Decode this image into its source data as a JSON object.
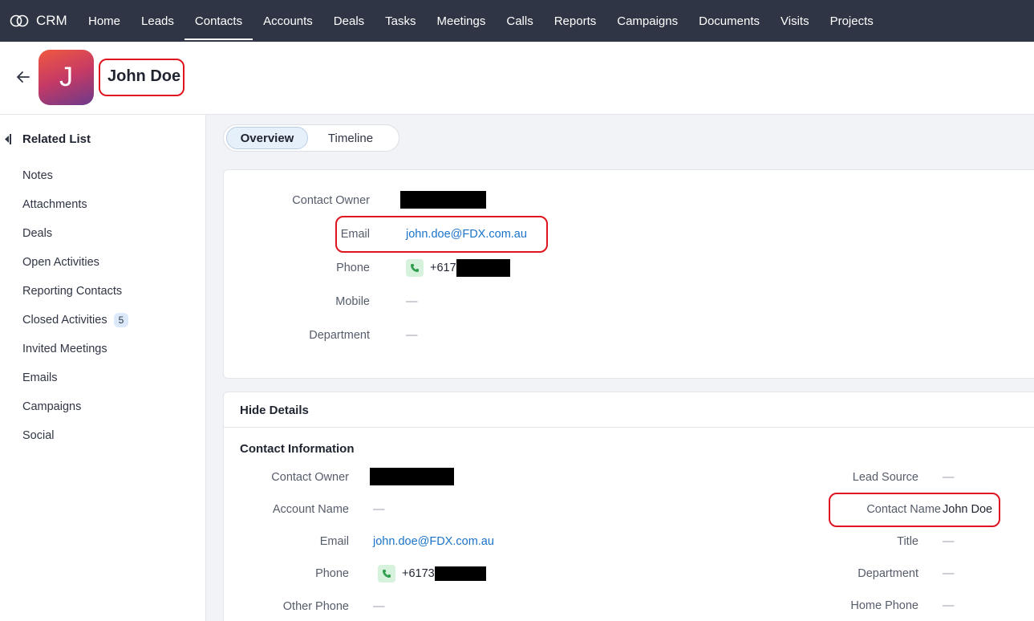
{
  "nav": {
    "brand": "CRM",
    "items": [
      "Home",
      "Leads",
      "Contacts",
      "Accounts",
      "Deals",
      "Tasks",
      "Meetings",
      "Calls",
      "Reports",
      "Campaigns",
      "Documents",
      "Visits",
      "Projects"
    ],
    "active": "Contacts"
  },
  "record": {
    "avatar_letter": "J",
    "name": "John Doe"
  },
  "sidebar": {
    "heading": "Related List",
    "items": [
      {
        "label": "Notes"
      },
      {
        "label": "Attachments"
      },
      {
        "label": "Deals"
      },
      {
        "label": "Open Activities"
      },
      {
        "label": "Reporting Contacts"
      },
      {
        "label": "Closed Activities",
        "count": "5"
      },
      {
        "label": "Invited Meetings"
      },
      {
        "label": "Emails"
      },
      {
        "label": "Campaigns"
      },
      {
        "label": "Social"
      }
    ]
  },
  "tabs": {
    "overview": "Overview",
    "timeline": "Timeline"
  },
  "overview": {
    "contact_owner_label": "Contact Owner",
    "email_label": "Email",
    "email_value": "john.doe@FDX.com.au",
    "phone_label": "Phone",
    "phone_value": "+617",
    "mobile_label": "Mobile",
    "mobile_value": "—",
    "department_label": "Department",
    "department_value": "—"
  },
  "details": {
    "toggle_label": "Hide Details",
    "section_title": "Contact Information",
    "left": {
      "contact_owner_label": "Contact Owner",
      "account_name_label": "Account Name",
      "account_name_value": "—",
      "email_label": "Email",
      "email_value": "john.doe@FDX.com.au",
      "phone_label": "Phone",
      "phone_value": "+6173",
      "other_phone_label": "Other Phone",
      "other_phone_value": "—"
    },
    "right": {
      "lead_source_label": "Lead Source",
      "lead_source_value": "—",
      "contact_name_label": "Contact Name",
      "contact_name_value": "John Doe",
      "title_label": "Title",
      "title_value": "—",
      "department_label": "Department",
      "department_value": "—",
      "home_phone_label": "Home Phone",
      "home_phone_value": "—"
    }
  },
  "colors": {
    "nav_bg": "#2f3544",
    "link": "#1a73c9",
    "highlight": "#e0141e",
    "phone_icon_bg": "#d6f2dc"
  }
}
